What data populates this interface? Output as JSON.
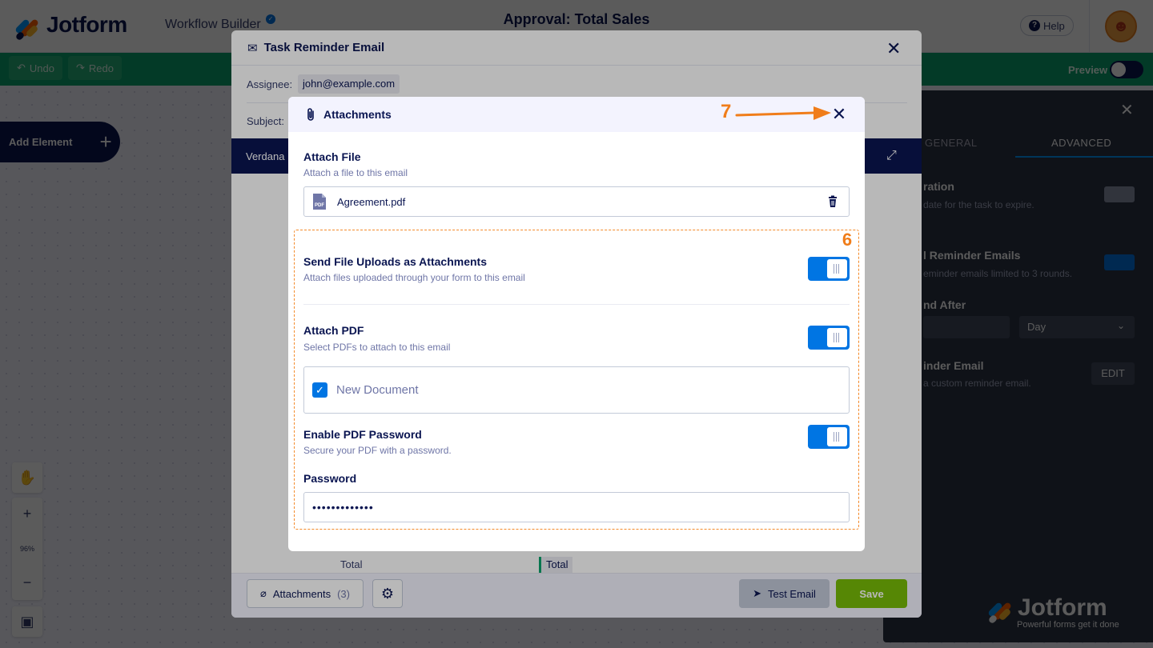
{
  "app": {
    "logo_text": "Jotform",
    "section": "Workflow Builder",
    "page_title": "Approval: Total Sales",
    "help_label": "Help"
  },
  "toolbar": {
    "undo_label": "Undo",
    "redo_label": "Redo",
    "preview_label": "Preview"
  },
  "canvas": {
    "add_element_label": "Add Element",
    "zoom_level": "96%"
  },
  "right_panel": {
    "tabs": [
      {
        "label": "GENERAL"
      },
      {
        "label": "ADVANCED"
      }
    ],
    "active_tab": "ADVANCED",
    "items": [
      {
        "title": "ration",
        "sub": "date for the task to expire."
      },
      {
        "title": "l Reminder Emails",
        "sub": "eminder emails limited to 3 rounds."
      },
      {
        "title": "nd After"
      },
      {
        "title": "inder Email",
        "sub": "a custom reminder email."
      }
    ],
    "select_value": "Day",
    "edit_label": "EDIT",
    "brand_text": "Jotform",
    "brand_tagline": "Powerful forms get it done"
  },
  "email_modal": {
    "title": "Task Reminder Email",
    "assignee_label": "Assignee:",
    "assignee_value": "john@example.com",
    "subject_label": "Subject:",
    "font_name": "Verdana",
    "table_total_label": "Total",
    "table_total_value": "Total",
    "attachments_label": "Attachments",
    "attachments_count": "(3)",
    "test_email_label": "Test Email",
    "save_label": "Save"
  },
  "attachments_modal": {
    "title": "Attachments",
    "attach_file": {
      "title": "Attach File",
      "subtitle": "Attach a file to this email",
      "file_name": "Agreement.pdf",
      "file_icon_text": "PDF"
    },
    "send_uploads": {
      "title": "Send File Uploads as Attachments",
      "subtitle": "Attach files uploaded through your form to this email",
      "enabled": true
    },
    "attach_pdf": {
      "title": "Attach PDF",
      "subtitle": "Select PDFs to attach to this email",
      "enabled": true,
      "documents": [
        {
          "label": "New Document",
          "checked": true
        }
      ]
    },
    "pdf_password": {
      "title": "Enable PDF Password",
      "subtitle": "Secure your PDF with a password.",
      "enabled": true,
      "password_label": "Password",
      "password_value": "•••••••••••••"
    }
  },
  "annotations": {
    "step_close": "7",
    "step_section": "6",
    "color": "#f07d1a"
  }
}
